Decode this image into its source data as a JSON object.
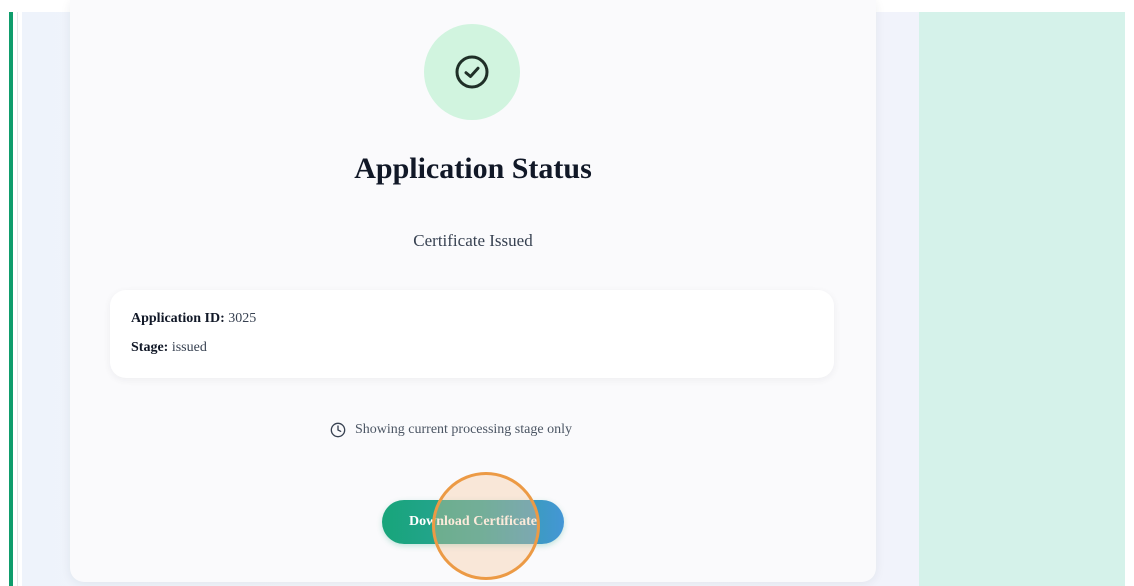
{
  "status_card": {
    "title": "Application Status",
    "status_text": "Certificate Issued",
    "icon": "check-circle-icon"
  },
  "info": {
    "application_id_label": "Application ID:",
    "application_id_value": "3025",
    "stage_label": "Stage:",
    "stage_value": "issued"
  },
  "note": {
    "icon": "clock-icon",
    "text": "Showing current processing stage only"
  },
  "actions": {
    "download_label": "Download Certificate"
  },
  "colors": {
    "accent": "#0f9d6c",
    "icon_bg": "#d1f4df",
    "side_panel": "#d5f2ea",
    "button_start": "#17a57a",
    "button_end": "#4496d6",
    "click_marker": "#ec9a45"
  }
}
